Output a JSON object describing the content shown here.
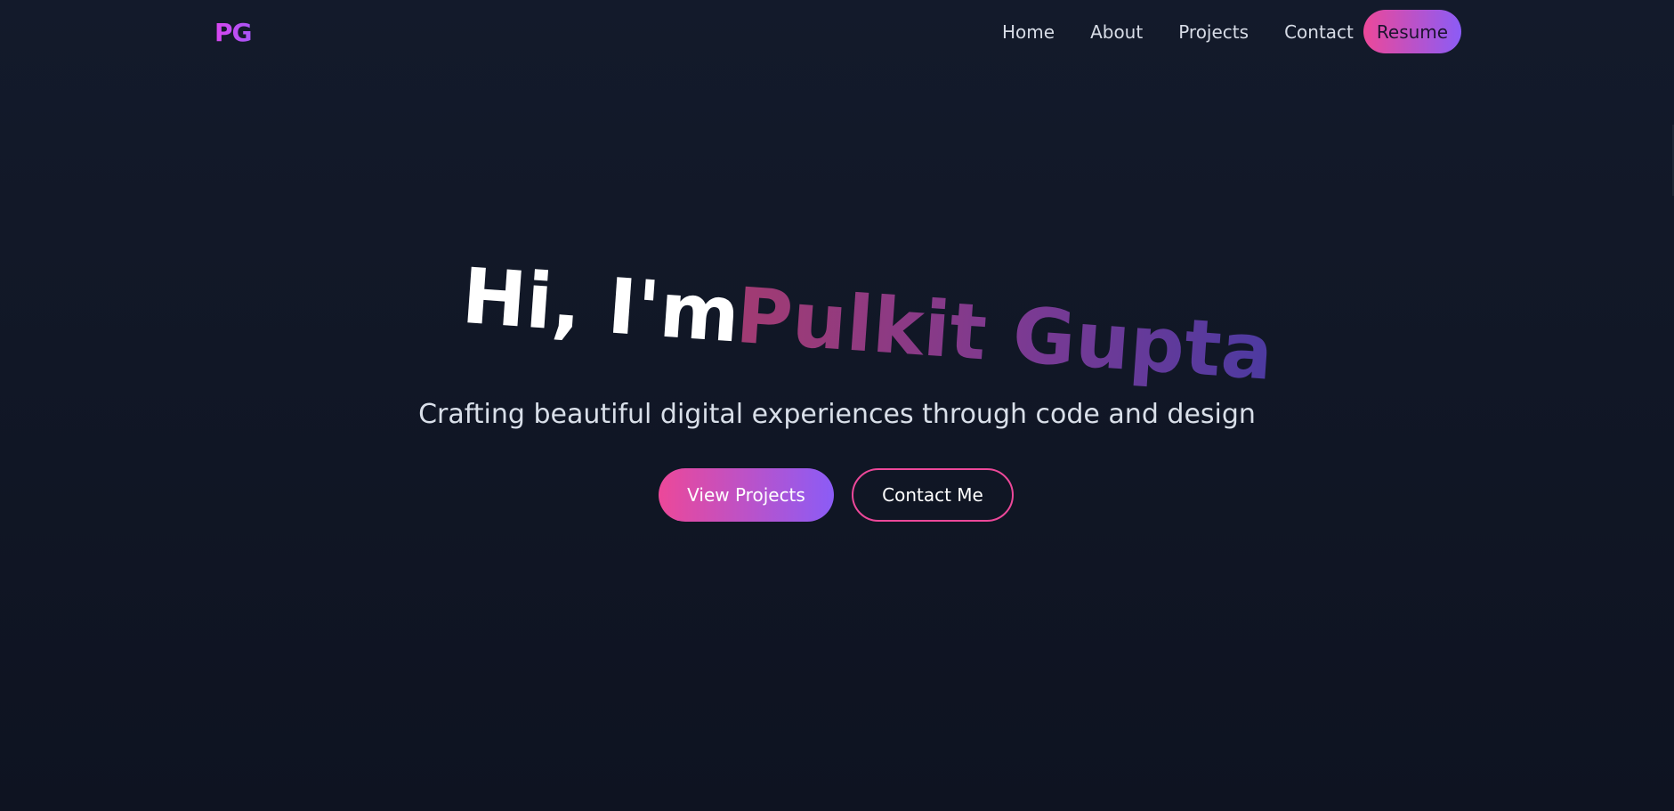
{
  "nav": {
    "logo_text": "PG",
    "links": [
      {
        "label": "Home"
      },
      {
        "label": "About"
      },
      {
        "label": "Projects"
      },
      {
        "label": "Contact"
      }
    ],
    "resume_label": "Resume"
  },
  "hero": {
    "greeting": "Hi, I'm",
    "name": "Pulkit Gupta",
    "subtitle": "Crafting beautiful digital experiences through code and design",
    "primary_button": "View Projects",
    "secondary_button": "Contact Me"
  },
  "colors": {
    "background": "#121827",
    "accent_start": "#ec4899",
    "accent_end": "#8b5cf6",
    "text_primary": "#ffffff",
    "text_muted": "#d9dfe9"
  }
}
